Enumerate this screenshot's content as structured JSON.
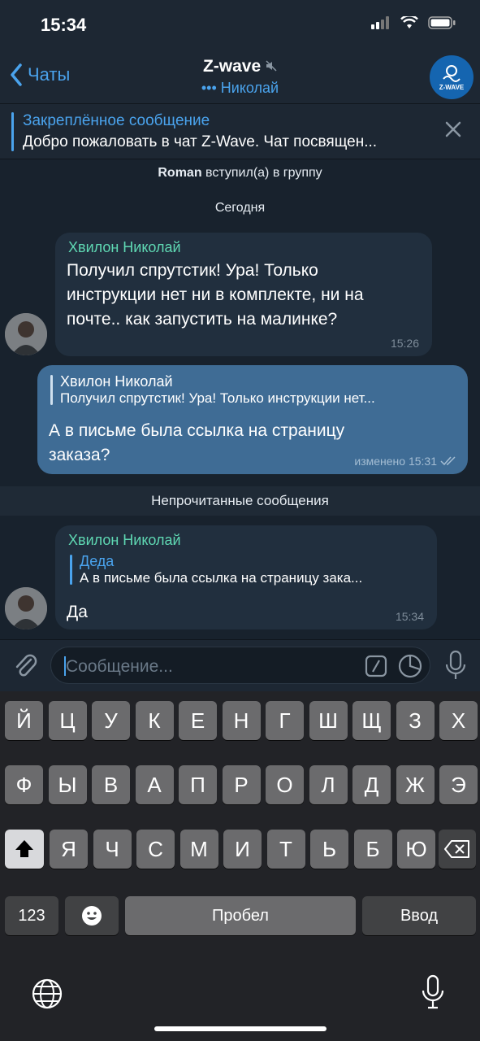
{
  "status": {
    "time": "15:34"
  },
  "header": {
    "back_label": "Чаты",
    "title": "Z-wave",
    "typing": "Николай",
    "logo_text": "Z-WAVE"
  },
  "pinned": {
    "title": "Закреплённое сообщение",
    "text": "Добро пожаловать в чат Z-Wave. Чат посвящен..."
  },
  "service": {
    "joined_name": "Roman",
    "joined_text": "вступил(а) в группу",
    "date": "Сегодня"
  },
  "messages": [
    {
      "sender": "Хвилон Николай",
      "lines": [
        "Получил спрутстик! Ура! Только",
        "инструкции нет ни в комплекте, ни на",
        "почте..  как запустить на малинке?"
      ],
      "time": "15:26"
    },
    {
      "reply_name": "Хвилон Николай",
      "reply_text": "Получил спрутстик! Ура! Только инструкции нет...",
      "lines": [
        "А в письме была ссылка на страницу",
        "заказа?"
      ],
      "time": "изменено 15:31"
    },
    {
      "sender": "Хвилон Николай",
      "reply_name": "Деда",
      "reply_text": "А в письме была ссылка на страницу зака...",
      "lines": [
        "Да"
      ],
      "time": "15:34"
    }
  ],
  "unread_label": "Непрочитанные сообщения",
  "input": {
    "placeholder": "Сообщение..."
  },
  "keyboard": {
    "row1": [
      "Й",
      "Ц",
      "У",
      "К",
      "Е",
      "Н",
      "Г",
      "Ш",
      "Щ",
      "З",
      "Х"
    ],
    "row2": [
      "Ф",
      "Ы",
      "В",
      "А",
      "П",
      "Р",
      "О",
      "Л",
      "Д",
      "Ж",
      "Э"
    ],
    "row3": [
      "Я",
      "Ч",
      "С",
      "М",
      "И",
      "Т",
      "Ь",
      "Б",
      "Ю"
    ],
    "numbers": "123",
    "space": "Пробел",
    "enter": "Ввод"
  },
  "colors": {
    "accent": "#4aa3ed",
    "sender": "#5fd8b3",
    "outgoing": "#3f6c95",
    "incoming": "#212f3e"
  }
}
